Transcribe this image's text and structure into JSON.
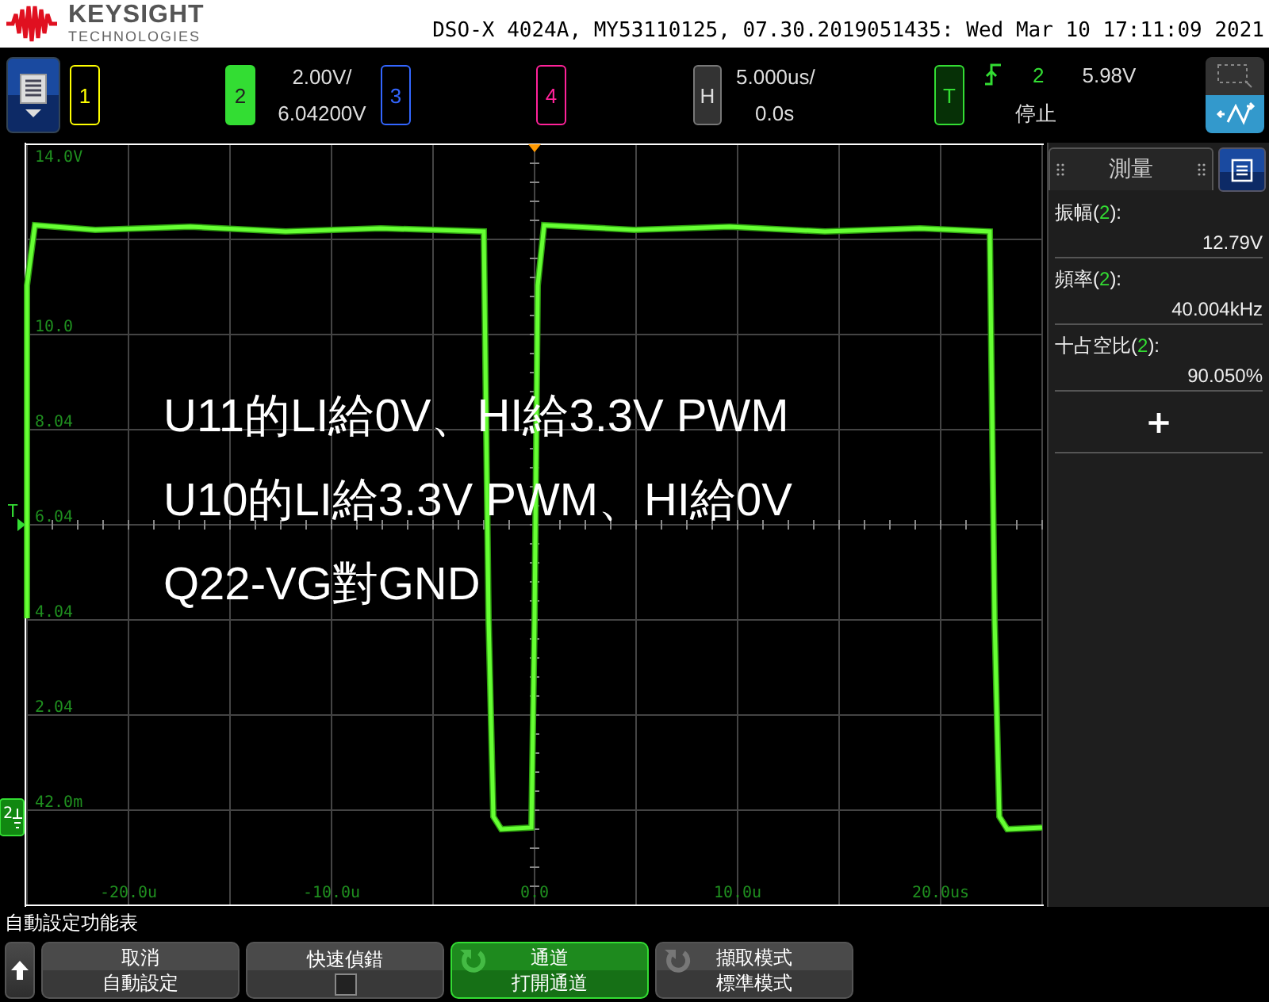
{
  "header": {
    "brand": "KEYSIGHT",
    "brand_sub": "TECHNOLOGIES",
    "title": "DSO-X 4024A, MY53110125, 07.30.2019051435: Wed Mar 10 17:11:09 2021"
  },
  "channels": [
    {
      "label": "1",
      "color": "#ffff00",
      "on": false
    },
    {
      "label": "2",
      "color": "#33dd33",
      "on": true,
      "scale": "2.00V/",
      "offset": "6.04200V"
    },
    {
      "label": "3",
      "color": "#3366ff",
      "on": false
    },
    {
      "label": "4",
      "color": "#ff2299",
      "on": false
    }
  ],
  "horizontal": {
    "label": "H",
    "scale": "5.000us/",
    "delay": "0.0s"
  },
  "trigger": {
    "label": "T",
    "source": "2",
    "level": "5.98V",
    "status": "停止"
  },
  "plot": {
    "y_labels": [
      "14.0V",
      "10.0",
      "8.04",
      "6.04",
      "4.04",
      "2.04",
      "42.0m"
    ],
    "x_labels": [
      "-20.0u",
      "-10.0u",
      "0.0",
      "10.0u",
      "20.0us"
    ],
    "trigger_marker": "T",
    "ground_marker": "2",
    "annotation": [
      "U11的LI給0V、HI給3.3V PWM",
      "U10的LI給3.3V PWM、HI給0V",
      "Q22-VG對GND"
    ]
  },
  "measurements": {
    "title": "測量",
    "add": "+",
    "items": [
      {
        "label_start": "振幅(",
        "source": "2",
        "label_end": "):",
        "value": "12.79V"
      },
      {
        "label_start": "頻率(",
        "source": "2",
        "label_end": "):",
        "value": "40.004kHz"
      },
      {
        "label_start": "十占空比(",
        "source": "2",
        "label_end": "):",
        "value": "90.050%"
      }
    ]
  },
  "menu_title": "自動設定功能表",
  "softkeys": [
    {
      "kind": "button",
      "lines": [
        "取消",
        "自動設定"
      ],
      "active": false
    },
    {
      "kind": "checkbox",
      "lines": [
        "快速偵錯"
      ],
      "checked": false,
      "active": false
    },
    {
      "kind": "cycle",
      "lines": [
        "通道",
        "打開通道"
      ],
      "active": true
    },
    {
      "kind": "cycle",
      "lines": [
        "擷取模式",
        "標準模式"
      ],
      "active": false
    }
  ]
}
